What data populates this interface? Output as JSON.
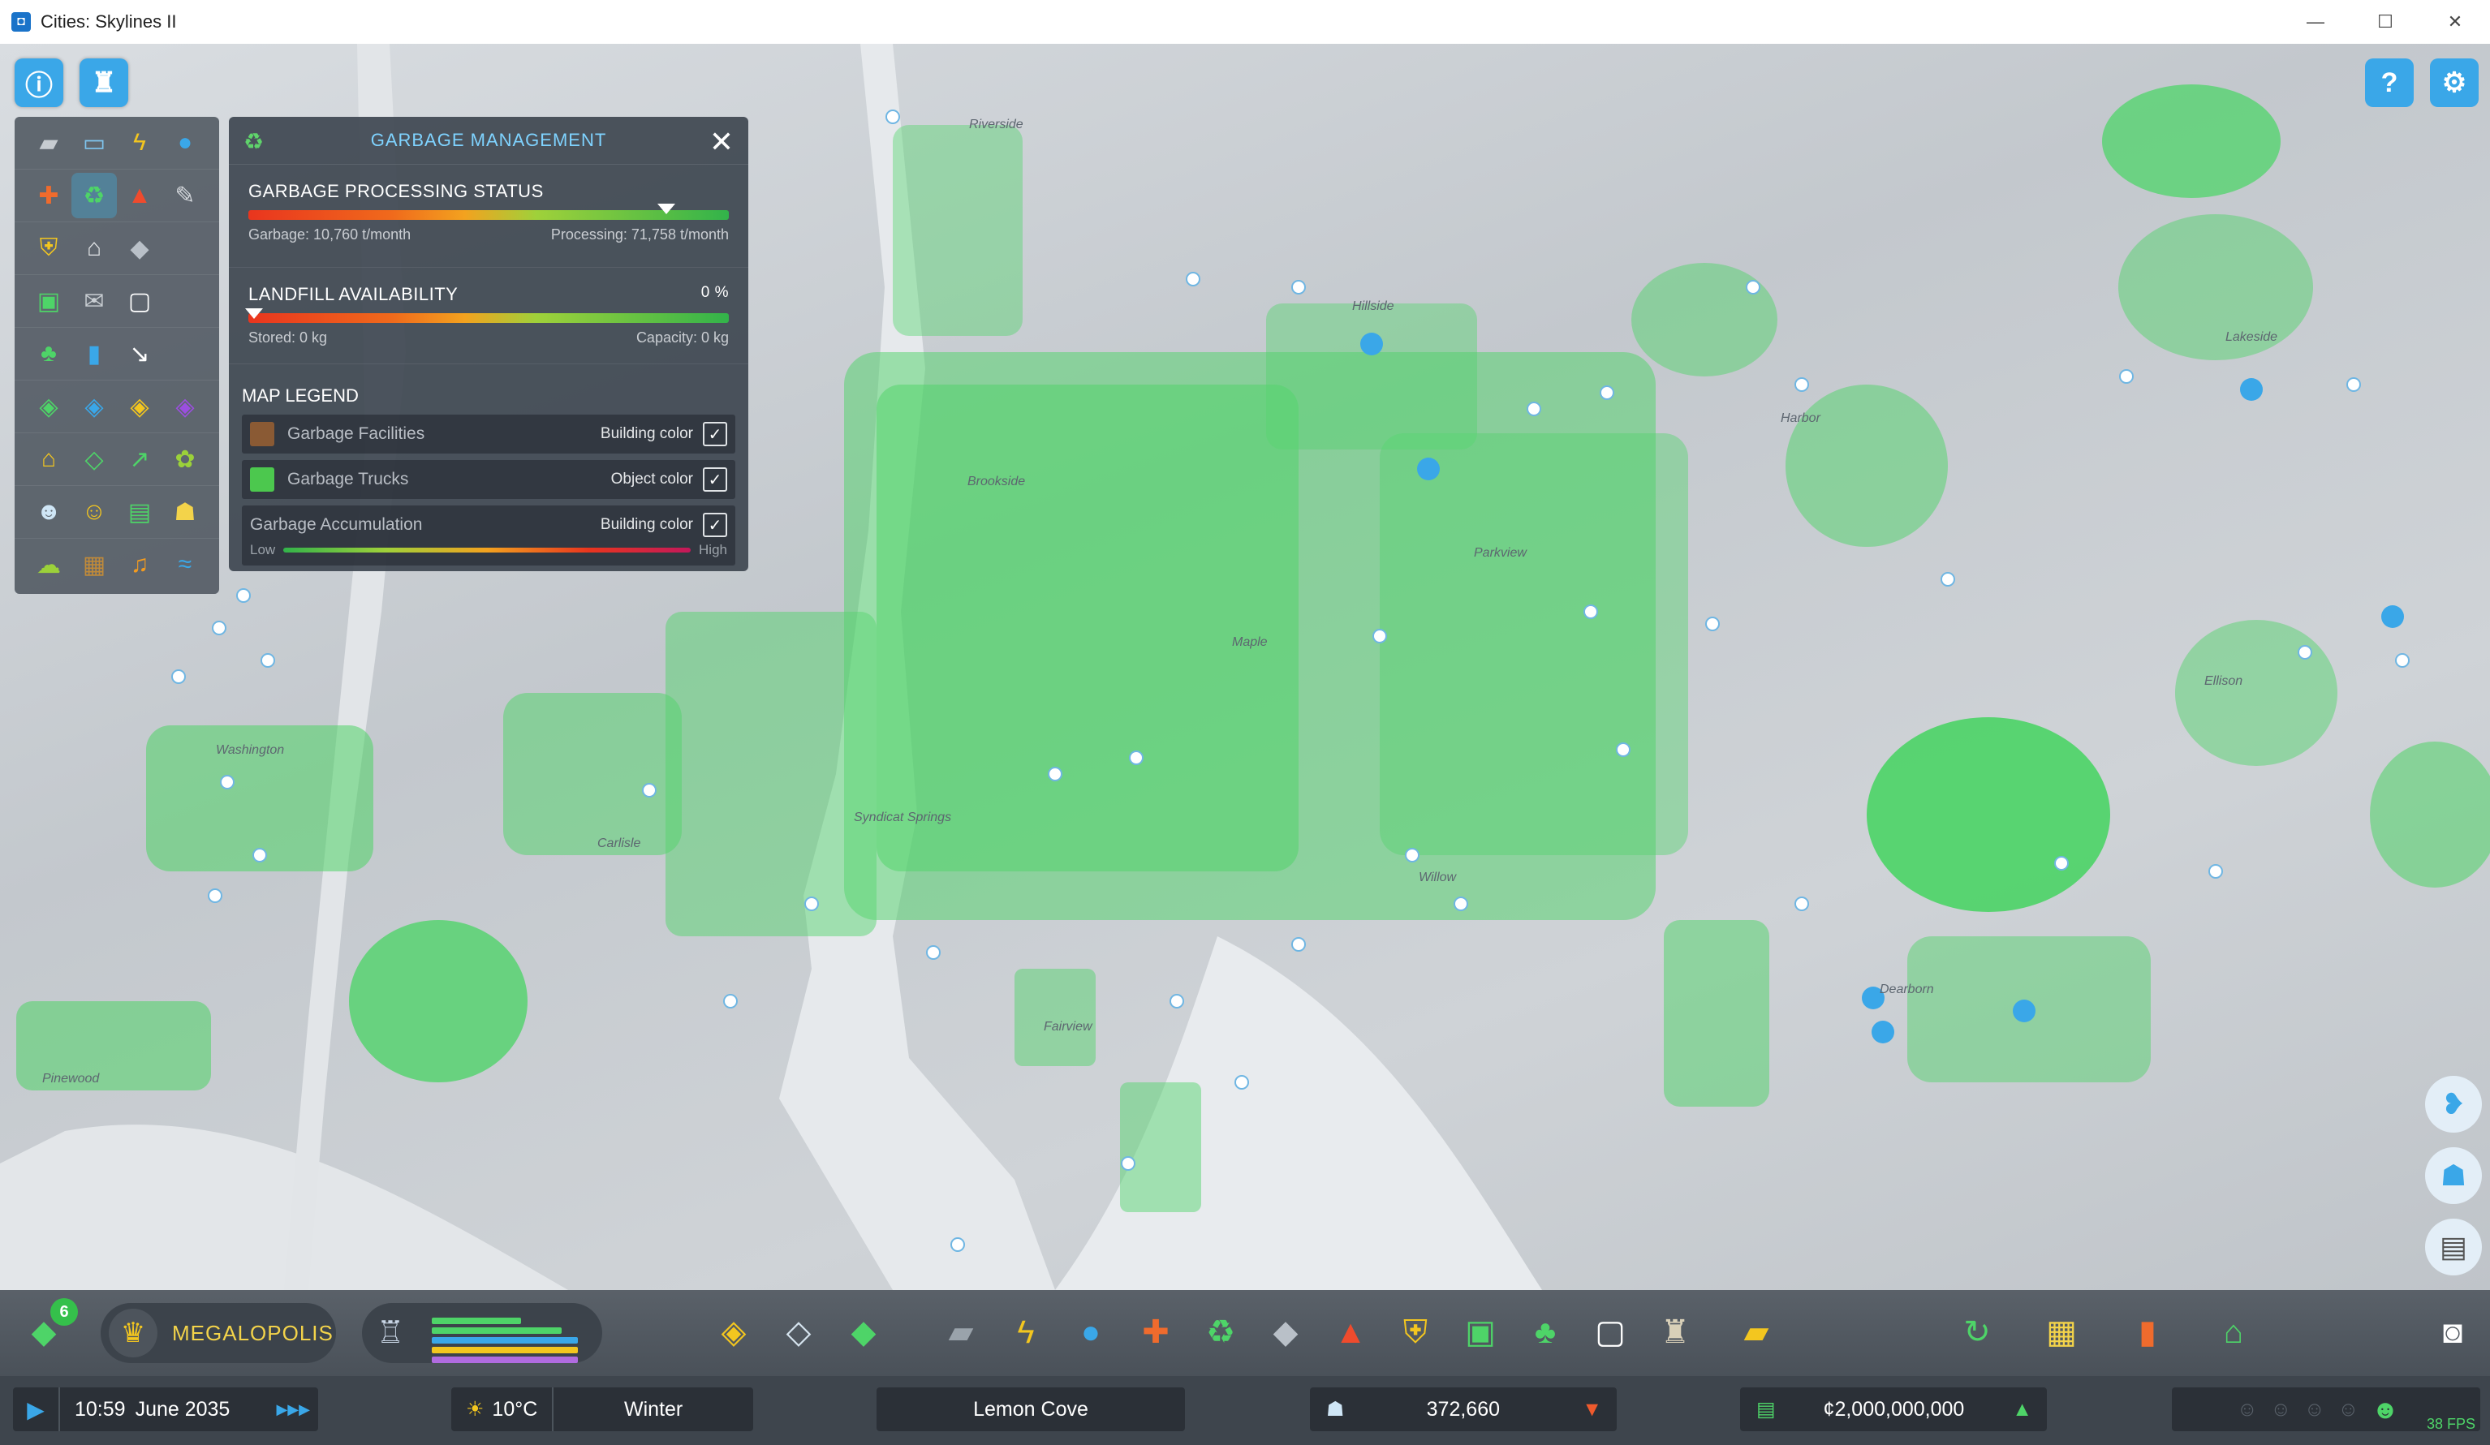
{
  "window": {
    "title": "Cities: Skylines II",
    "minimize": "—",
    "maximize": "☐",
    "close": "✕"
  },
  "top_left": {
    "info_icon": "info-icon",
    "advisor_icon": "chirper-avatar-icon"
  },
  "top_right": {
    "help_icon": "help-icon",
    "settings_icon": "gear-icon"
  },
  "infoview_icons": [
    [
      "road-icon",
      "electricity-network-icon",
      "lightning-icon",
      "water-drop-icon"
    ],
    [
      "healthcare-icon",
      "garbage-recycle-icon",
      "fire-icon",
      "wrench-icon"
    ],
    [
      "police-badge-icon",
      "bank-icon",
      "education-icon"
    ],
    [
      "transport-bus-icon",
      "mail-icon",
      "chat-icon"
    ],
    [
      "park-tree-icon",
      "trash-bin-icon",
      "arrow-icon"
    ],
    [
      "zone-residential-icon",
      "zone-commercial-icon",
      "zone-industrial-icon",
      "zone-office-icon"
    ],
    [
      "house-icon",
      "land-value-icon",
      "chart-icon",
      "plant-icon"
    ],
    [
      "population-icon",
      "happiness-icon",
      "money-icon",
      "workers-icon"
    ],
    [
      "terrain-icon",
      "soil-icon",
      "noise-icon",
      "water-icon"
    ]
  ],
  "panel": {
    "title": "GARBAGE MANAGEMENT",
    "close_label": "✕",
    "processing": {
      "title": "GARBAGE PROCESSING STATUS",
      "garbage": "Garbage: 10,760 t/month",
      "processing": "Processing: 71,758 t/month",
      "marker": 0.87
    },
    "landfill": {
      "title": "LANDFILL AVAILABILITY",
      "percent": "0 %",
      "stored": "Stored: 0 kg",
      "capacity": "Capacity: 0 kg",
      "marker": 0.0
    },
    "legend": {
      "title": "MAP LEGEND",
      "rows": [
        {
          "label": "Garbage Facilities",
          "type": "Building color",
          "color": "#8a5a34"
        },
        {
          "label": "Garbage Trucks",
          "type": "Object color",
          "color": "#4cc84e"
        },
        {
          "label": "Garbage Accumulation",
          "type": "Building color"
        }
      ],
      "low": "Low",
      "high": "High"
    }
  },
  "map_labels": [
    "Washington",
    "Pinewood",
    "Carlisle",
    "Syndicat Springs",
    "Willow",
    "Parkview",
    "Harbor",
    "Lakeside",
    "Ellison",
    "Riverside",
    "Hillside",
    "Brookside",
    "Maple",
    "Dearborn",
    "Fairview"
  ],
  "toolbar": {
    "milestone_badge": "6",
    "milestone_label": "MEGALOPOLIS",
    "tools": [
      "zoning-icon",
      "area-icon",
      "landscaping-icon",
      "road-icon",
      "electricity-icon",
      "water-icon",
      "healthcare-icon",
      "garbage-icon",
      "education-icon",
      "fire-icon",
      "police-icon",
      "transport-icon",
      "parks-icon",
      "communication-icon",
      "landmark-icon",
      "industry-icon"
    ],
    "right_tools": [
      "economy-icon",
      "map-tiles-icon",
      "statistics-icon",
      "progression-icon"
    ]
  },
  "side_buttons": [
    "chirper-icon",
    "citizen-icon",
    "journal-icon",
    "camera-icon"
  ],
  "status": {
    "time": "10:59",
    "date": "June 2035",
    "speed": "▶▶▶",
    "temperature": "10°C",
    "season": "Winter",
    "city": "Lemon Cove",
    "population": "372,660",
    "money": "¢2,000,000,000",
    "fps": "38 FPS"
  },
  "colors": {
    "accent": "#3aa7e8",
    "building_green": "#4ed468",
    "panel_bg": "#3e4650",
    "title_blue": "#7fd3ff"
  }
}
